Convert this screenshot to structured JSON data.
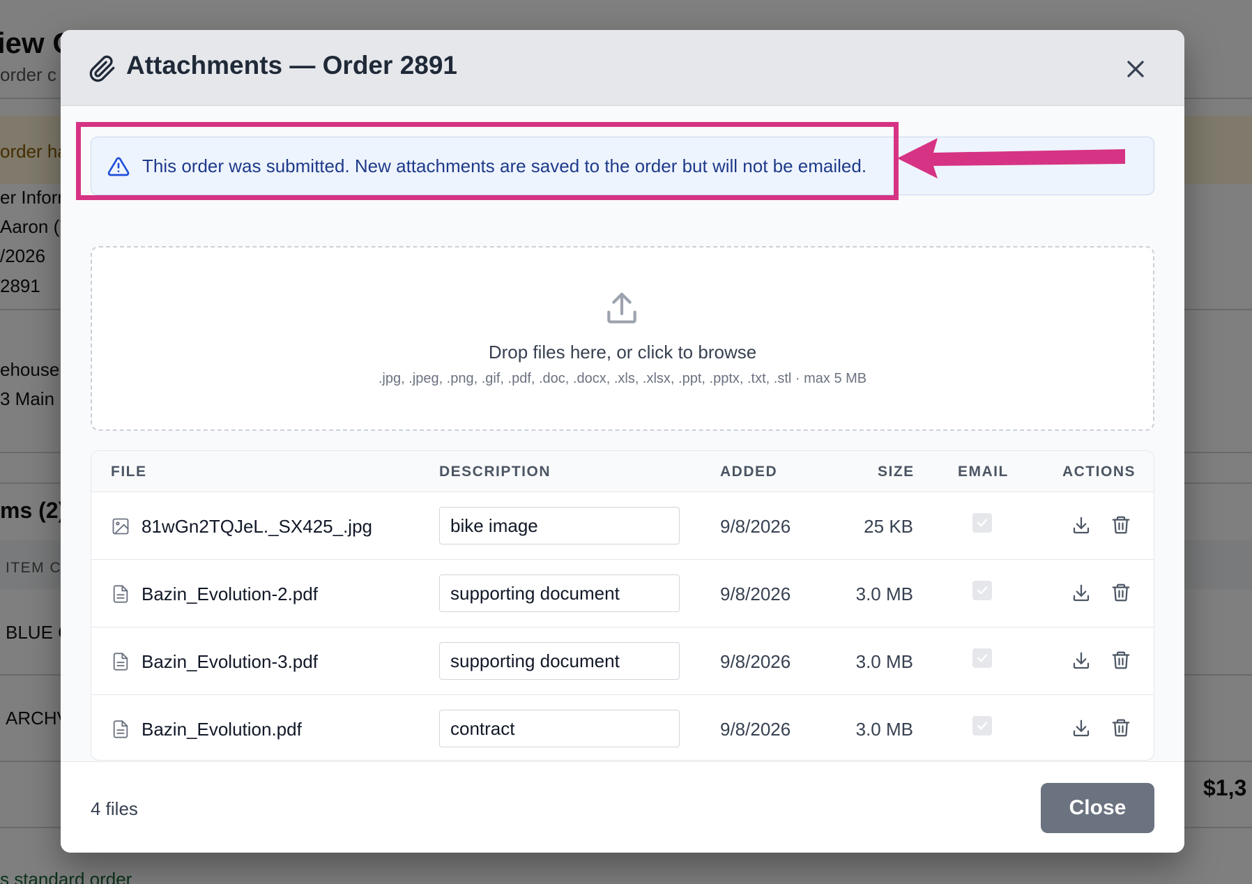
{
  "background": {
    "page_title_fragment": "iew C",
    "page_subtitle_fragment": "order c",
    "notice_fragment": "order ha",
    "info_fragment": "er Inform",
    "customer_fragment": "Aaron (7",
    "date_fragment": "/2026",
    "order_fragment": "2891",
    "warehouse_fragment": "ehouse",
    "address_fragment": "3 Main",
    "items_fragment": "ms (2)",
    "item_col_fragment": "ITEM C",
    "item1_fragment": "BLUE C",
    "item2_fragment": "ARCHV",
    "total_fragment": "$1,3",
    "footer_fragment": "s standard order"
  },
  "modal": {
    "title": "Attachments — Order 2891",
    "close_icon": "close-icon",
    "alert": {
      "text": "This order was submitted. New attachments are saved to the order but will not be emailed.",
      "icon": "warning-icon"
    },
    "dropzone": {
      "title": "Drop files here, or click to browse",
      "subtitle": ".jpg, .jpeg, .png, .gif, .pdf, .doc, .docx, .xls, .xlsx, .ppt, .pptx, .txt, .stl · max 5 MB"
    },
    "table": {
      "headers": {
        "file": "FILE",
        "description": "DESCRIPTION",
        "added": "ADDED",
        "size": "SIZE",
        "email": "EMAIL",
        "actions": "ACTIONS"
      },
      "rows": [
        {
          "file": "81wGn2TQJeL._SX425_.jpg",
          "icon": "image-icon",
          "description": "bike image",
          "added": "9/8/2026",
          "size": "25 KB",
          "email": true
        },
        {
          "file": "Bazin_Evolution-2.pdf",
          "icon": "document-icon",
          "description": "supporting document",
          "added": "9/8/2026",
          "size": "3.0 MB",
          "email": true
        },
        {
          "file": "Bazin_Evolution-3.pdf",
          "icon": "document-icon",
          "description": "supporting document",
          "added": "9/8/2026",
          "size": "3.0 MB",
          "email": true
        },
        {
          "file": "Bazin_Evolution.pdf",
          "icon": "document-icon",
          "description": "contract",
          "added": "9/8/2026",
          "size": "3.0 MB",
          "email": true
        }
      ]
    },
    "footer": {
      "file_count": "4 files",
      "close_label": "Close"
    }
  },
  "colors": {
    "annotation": "#d63384",
    "alert_bg": "#eef4fd",
    "alert_text": "#1e3a8a",
    "close_button": "#6b7280"
  }
}
